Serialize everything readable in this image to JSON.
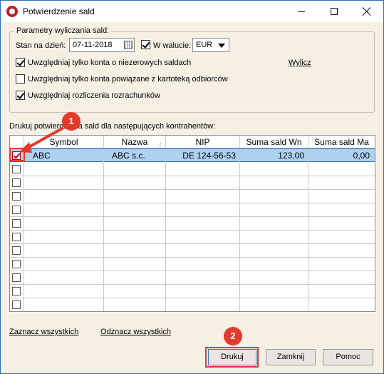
{
  "window": {
    "title": "Potwierdzenie sald",
    "controls": [
      "minimize",
      "maximize",
      "close"
    ]
  },
  "params": {
    "legend": "Parametry wyliczania sald:",
    "date_label": "Stan na dzień:",
    "date_value": "07-11-2018",
    "currency_checkbox_label": "W walucie:",
    "currency_checked": true,
    "currency_value": "EUR",
    "options": [
      {
        "label": "Uwzględniaj tylko konta o niezerowych saldach",
        "checked": true
      },
      {
        "label": "Uwzględniaj tylko konta powiązane z kartoteką odbiorców",
        "checked": false
      },
      {
        "label": "Uwzględniaj rozliczenia rozrachunków",
        "checked": true
      }
    ],
    "compute_link": "Wylicz"
  },
  "grid": {
    "caption": "Drukuj potwierdzenia sald dla następujących kontrahentów:",
    "columns": [
      "",
      "Symbol",
      "Nazwa",
      "NIP",
      "Suma sald Wn",
      "Suma sald Ma"
    ],
    "rows": [
      {
        "checked": true,
        "symbol": "ABC",
        "name": "ABC s.c.",
        "nip": "DE 124-56-53",
        "wn": "123,00",
        "ma": "0,00"
      }
    ],
    "empty_rows": 11
  },
  "links": {
    "select_all": "Zaznacz wszystkich",
    "deselect_all": "Odznacz wszystkich"
  },
  "buttons": {
    "print": "Drukuj",
    "close": "Zamknij",
    "help": "Pomoc"
  },
  "callouts": [
    "1",
    "2"
  ],
  "colors": {
    "accent": "#e43a2d",
    "selection": "#aed1ee",
    "dialog_bg": "#f5efe4"
  }
}
